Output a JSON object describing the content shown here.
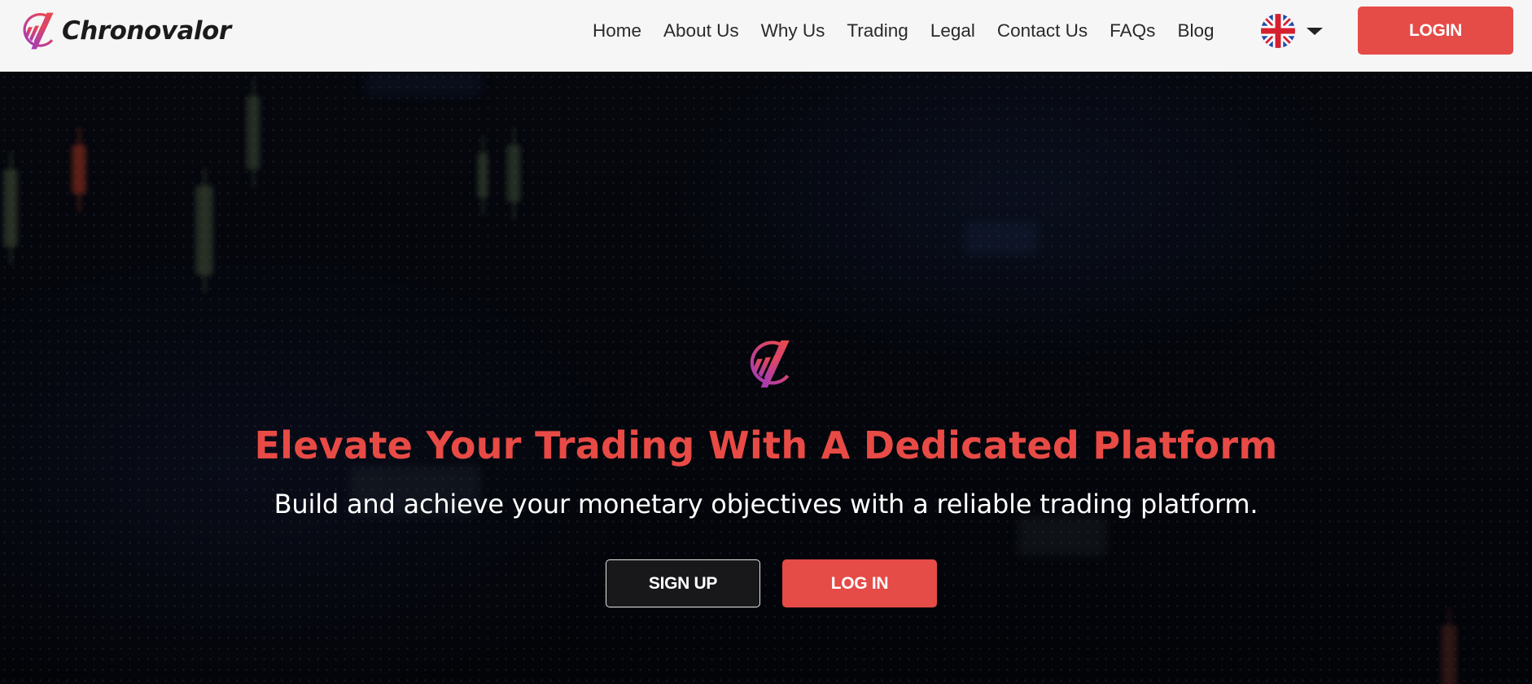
{
  "header": {
    "brand_name": "Chronovalor",
    "brand_icon": "chronovalor-logo-icon",
    "nav": [
      {
        "label": "Home"
      },
      {
        "label": "About Us"
      },
      {
        "label": "Why Us"
      },
      {
        "label": "Trading"
      },
      {
        "label": "Legal"
      },
      {
        "label": "Contact Us"
      },
      {
        "label": "FAQs"
      },
      {
        "label": "Blog"
      }
    ],
    "language": {
      "selected": "English (UK)",
      "icon": "uk-flag-icon"
    },
    "login_label": "LOGIN"
  },
  "hero": {
    "title": "Elevate Your Trading With A Dedicated Platform",
    "subtitle": "Build and achieve your monetary objectives with a reliable trading platform.",
    "signup_label": "SIGN UP",
    "login_label": "LOG IN"
  },
  "colors": {
    "accent": "#e54b47",
    "header_bg": "#f6f6f6",
    "hero_bg": "#04050a",
    "logo_gradient_start": "#f0494d",
    "logo_gradient_end": "#b03ab8"
  }
}
